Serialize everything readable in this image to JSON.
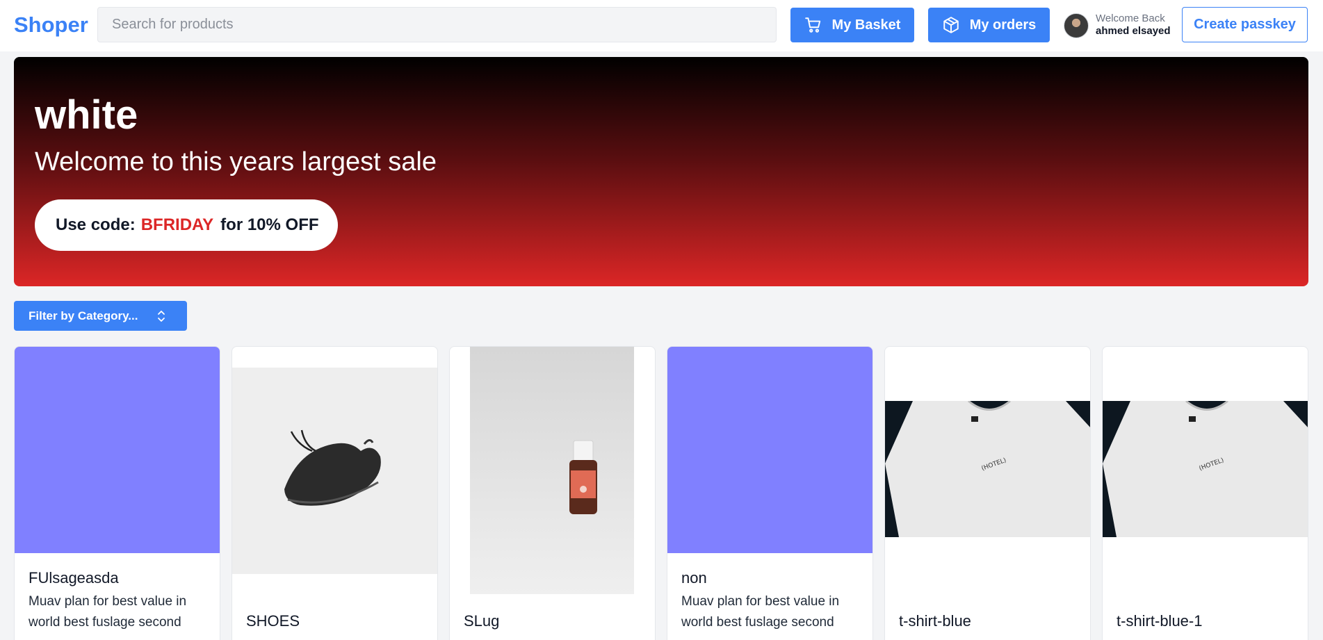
{
  "header": {
    "logo": "Shoper",
    "search_placeholder": "Search for products",
    "basket_label": "My Basket",
    "orders_label": "My orders",
    "welcome_text": "Welcome Back",
    "user_name": "ahmed elsayed",
    "passkey_label": "Create passkey"
  },
  "banner": {
    "title": "white",
    "subtitle": "Welcome to this years largest sale",
    "promo_prefix": "Use code:",
    "promo_code": "BFRIDAY",
    "promo_suffix": "for 10% OFF"
  },
  "filter": {
    "label": "Filter by Category..."
  },
  "products": [
    {
      "name": "FUlsageasda",
      "description": "Muav plan for best value in world best fuslage second"
    },
    {
      "name": "SHOES",
      "description": ""
    },
    {
      "name": "SLug",
      "description": ""
    },
    {
      "name": "non",
      "description": "Muav plan for best value in world best fuslage second"
    },
    {
      "name": "t-shirt-blue",
      "description": ""
    },
    {
      "name": "t-shirt-blue-1",
      "description": ""
    }
  ],
  "colors": {
    "brand": "#3b82f6",
    "promo_code": "#dc2626",
    "placeholder_image": "#8080ff"
  }
}
